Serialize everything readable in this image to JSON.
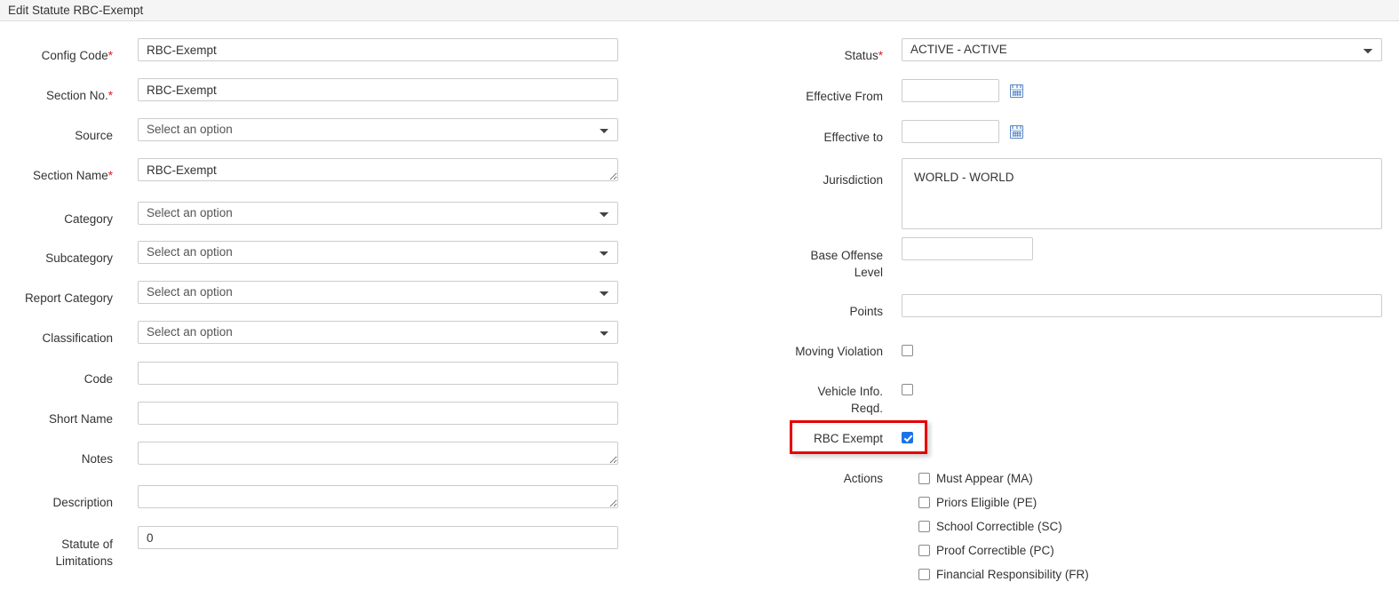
{
  "window": {
    "title": "Edit Statute RBC-Exempt"
  },
  "left_column": {
    "fields": [
      {
        "label": "Config Code",
        "required": true,
        "type": "text",
        "value": "RBC-Exempt",
        "name": "config-code"
      },
      {
        "label": "Section No.",
        "required": true,
        "type": "text",
        "value": "RBC-Exempt",
        "name": "section-no"
      },
      {
        "label": "Source",
        "required": false,
        "type": "select",
        "value": "Select an option",
        "name": "source"
      },
      {
        "label": "Section Name",
        "required": true,
        "type": "textarea",
        "value": "RBC-Exempt",
        "name": "section-name"
      },
      {
        "label": "Category",
        "required": false,
        "type": "select",
        "value": "Select an option",
        "name": "category"
      },
      {
        "label": "Subcategory",
        "required": false,
        "type": "select",
        "value": "Select an option",
        "name": "subcategory"
      },
      {
        "label": "Report Category",
        "required": false,
        "type": "select",
        "value": "Select an option",
        "name": "report-category"
      },
      {
        "label": "Classification",
        "required": false,
        "type": "select",
        "value": "Select an option",
        "name": "classification"
      },
      {
        "label": "Code",
        "required": false,
        "type": "text",
        "value": "",
        "name": "code"
      },
      {
        "label": "Short Name",
        "required": false,
        "type": "text",
        "value": "",
        "name": "short-name"
      },
      {
        "label": "Notes",
        "required": false,
        "type": "textarea",
        "value": "",
        "name": "notes"
      },
      {
        "label": "Description",
        "required": false,
        "type": "textarea",
        "value": "",
        "name": "description"
      },
      {
        "label": "Statute of Limitations",
        "required": false,
        "type": "text",
        "value": "0",
        "name": "statute-of-limitations"
      }
    ]
  },
  "right_column": {
    "status": {
      "label": "Status",
      "required": true,
      "value": "ACTIVE - ACTIVE"
    },
    "effective_from": {
      "label": "Effective From",
      "value": ""
    },
    "effective_to": {
      "label": "Effective to",
      "value": ""
    },
    "jurisdiction": {
      "label": "Jurisdiction",
      "value": "WORLD - WORLD"
    },
    "base_offense_level": {
      "label": "Base Offense Level",
      "value": ""
    },
    "points": {
      "label": "Points",
      "value": ""
    },
    "moving_violation": {
      "label": "Moving Violation",
      "checked": false
    },
    "vehicle_info_reqd": {
      "label": "Vehicle Info. Reqd.",
      "checked": false
    },
    "rbc_exempt": {
      "label": "RBC Exempt",
      "checked": true,
      "highlight_color": "#e60000"
    },
    "actions": {
      "label": "Actions",
      "items": [
        {
          "label": "Must Appear (MA)",
          "checked": false,
          "name": "must-appear"
        },
        {
          "label": "Priors Eligible (PE)",
          "checked": false,
          "name": "priors-eligible"
        },
        {
          "label": "School Correctible (SC)",
          "checked": false,
          "name": "school-correctible"
        },
        {
          "label": "Proof Correctible (PC)",
          "checked": false,
          "name": "proof-correctible"
        },
        {
          "label": "Financial Responsibility (FR)",
          "checked": false,
          "name": "financial-responsibility"
        }
      ]
    }
  },
  "icons": {
    "calendar": "calendar-icon",
    "chevron_down": "chevron-down-icon"
  }
}
